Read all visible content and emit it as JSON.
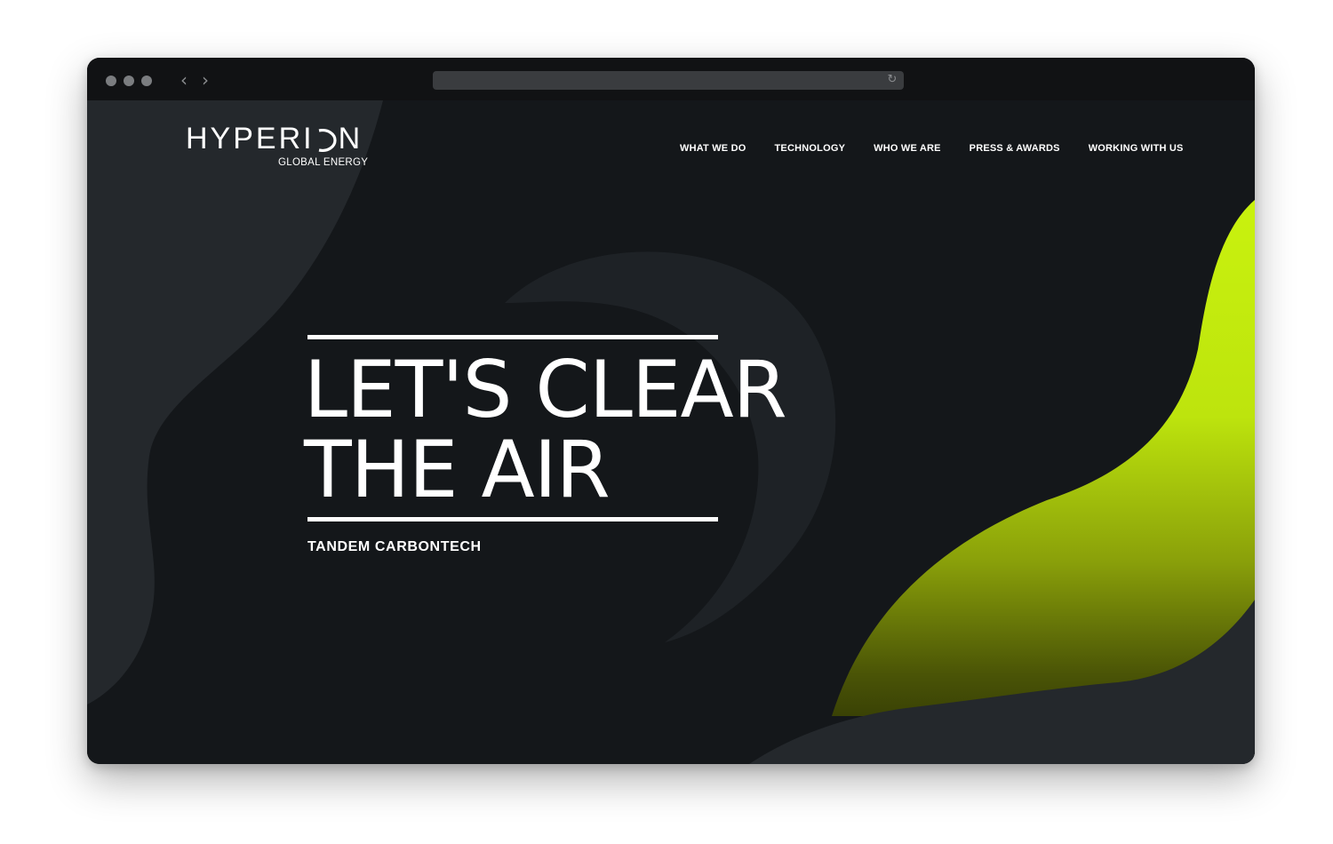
{
  "browser": {
    "window_buttons": [
      "close",
      "minimize",
      "maximize"
    ],
    "back_icon": "chevron-left-icon",
    "forward_icon": "chevron-right-icon",
    "reload_icon": "reload-icon",
    "url": ""
  },
  "brand": {
    "name": "HYPERI",
    "name_end": "N",
    "tagline": "GLOBAL ENERGY"
  },
  "nav": {
    "items": [
      {
        "label": "WHAT WE DO"
      },
      {
        "label": "TECHNOLOGY"
      },
      {
        "label": "WHO WE ARE"
      },
      {
        "label": "PRESS & AWARDS"
      },
      {
        "label": "WORKING WITH US"
      }
    ]
  },
  "hero": {
    "headline_line1": "LET'S CLEAR",
    "headline_line2": "THE AIR",
    "subheading": "TANDEM CARBONTECH"
  },
  "colors": {
    "background": "#14171a",
    "shape": "#24282c",
    "accent": "#c6f00f",
    "titlebar": "#111214"
  }
}
